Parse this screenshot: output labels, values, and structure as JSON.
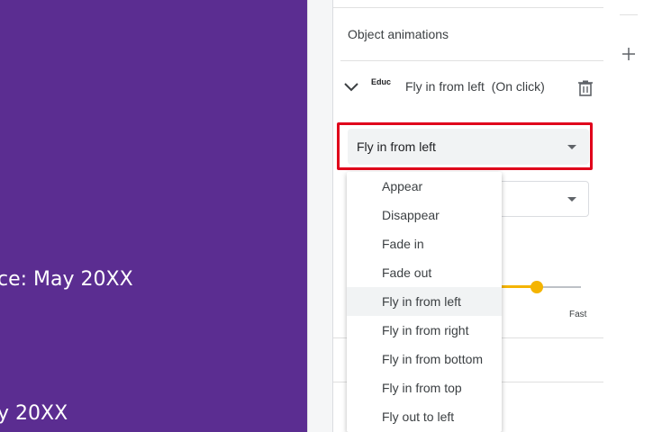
{
  "slide": {
    "text_line_1": "ce: May 20XX",
    "text_line_2": "y 20XX",
    "background_color": "#5b2d91"
  },
  "panel": {
    "section_title": "Object animations",
    "animation_item": {
      "object_name": "Educ",
      "description": "Fly in from left  (On click)",
      "expand_icon": "chevron-down-icon",
      "delete_icon": "trash-icon"
    },
    "animation_type_select": {
      "value": "Fly in from left"
    },
    "speed_slider": {
      "fast_label": "Fast",
      "value_fraction": 0.45
    }
  },
  "dropdown": {
    "options": [
      "Appear",
      "Disappear",
      "Fade in",
      "Fade out",
      "Fly in from left",
      "Fly in from right",
      "Fly in from bottom",
      "Fly in from top",
      "Fly out to left"
    ],
    "selected": "Fly in from left"
  },
  "right_strip": {
    "add_icon": "plus-icon"
  },
  "colors": {
    "highlight_border": "#e0001b",
    "accent": "#f4b400"
  }
}
